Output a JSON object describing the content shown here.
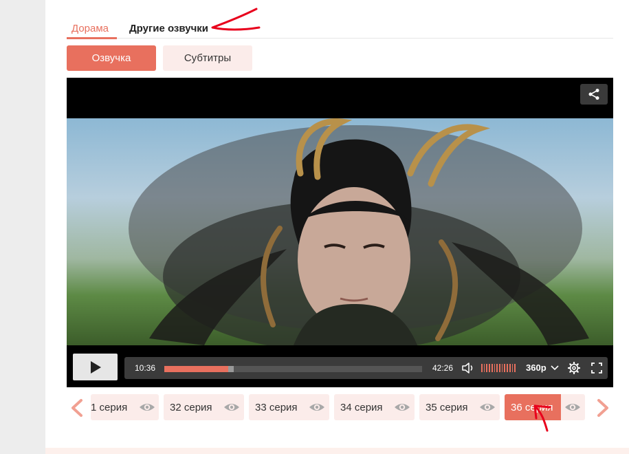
{
  "tabs": {
    "dorama": "Дорама",
    "other_voices": "Другие озвучки"
  },
  "modes": {
    "voice": "Озвучка",
    "subtitles": "Субтитры"
  },
  "player": {
    "current_time": "10:36",
    "duration": "42:26",
    "progress_fraction": 0.249,
    "buffered_fraction": 0.27,
    "quality": "360p",
    "volume_bars": 14
  },
  "episodes": [
    {
      "label": "1 серия",
      "active": false
    },
    {
      "label": "32 серия",
      "active": false
    },
    {
      "label": "33 серия",
      "active": false
    },
    {
      "label": "34 серия",
      "active": false
    },
    {
      "label": "35 серия",
      "active": false
    },
    {
      "label": "36 серия",
      "active": true
    }
  ],
  "colors": {
    "accent": "#e8705e",
    "accent_light": "#fbecea",
    "annotation": "#e8001c"
  }
}
